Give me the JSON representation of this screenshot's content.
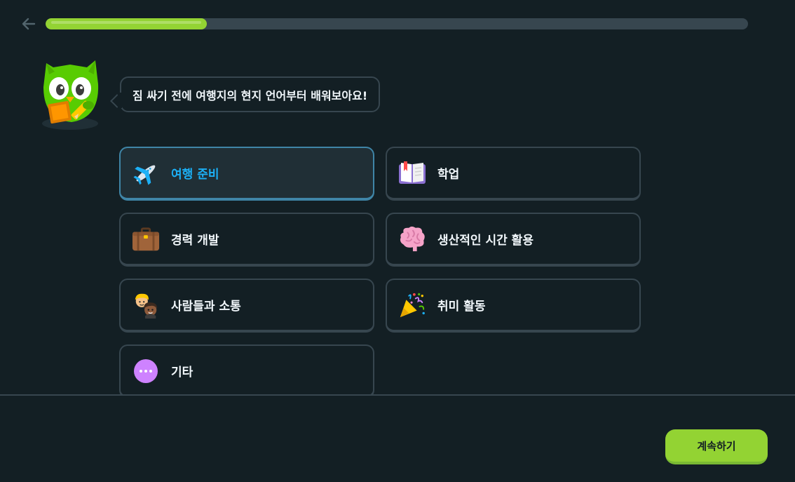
{
  "header": {
    "back_icon": "arrow-left-icon",
    "progress": 0.23,
    "progress_color": "#93d333"
  },
  "mascot": {
    "icon": "owl-mascot-icon",
    "color": "#58cc02"
  },
  "speech": {
    "text": "짐 싸기 전에 여행지의 현지 언어부터 배워보아요!"
  },
  "options": [
    {
      "label": "여행 준비",
      "icon": "airplane-icon",
      "selected": true
    },
    {
      "label": "학업",
      "icon": "book-icon",
      "selected": false
    },
    {
      "label": "경력 개발",
      "icon": "briefcase-icon",
      "selected": false
    },
    {
      "label": "생산적인 시간 활용",
      "icon": "brain-icon",
      "selected": false
    },
    {
      "label": "사람들과 소통",
      "icon": "people-icon",
      "selected": false
    },
    {
      "label": "취미 활동",
      "icon": "party-popper-icon",
      "selected": false
    },
    {
      "label": "기타",
      "icon": "more-dots-icon",
      "selected": false
    }
  ],
  "footer": {
    "continue_label": "계속하기"
  },
  "colors": {
    "background": "#131f24",
    "border": "#37464f",
    "selected_border": "#3f85a7",
    "selected_text": "#1cb0f6",
    "accent": "#93d333"
  }
}
